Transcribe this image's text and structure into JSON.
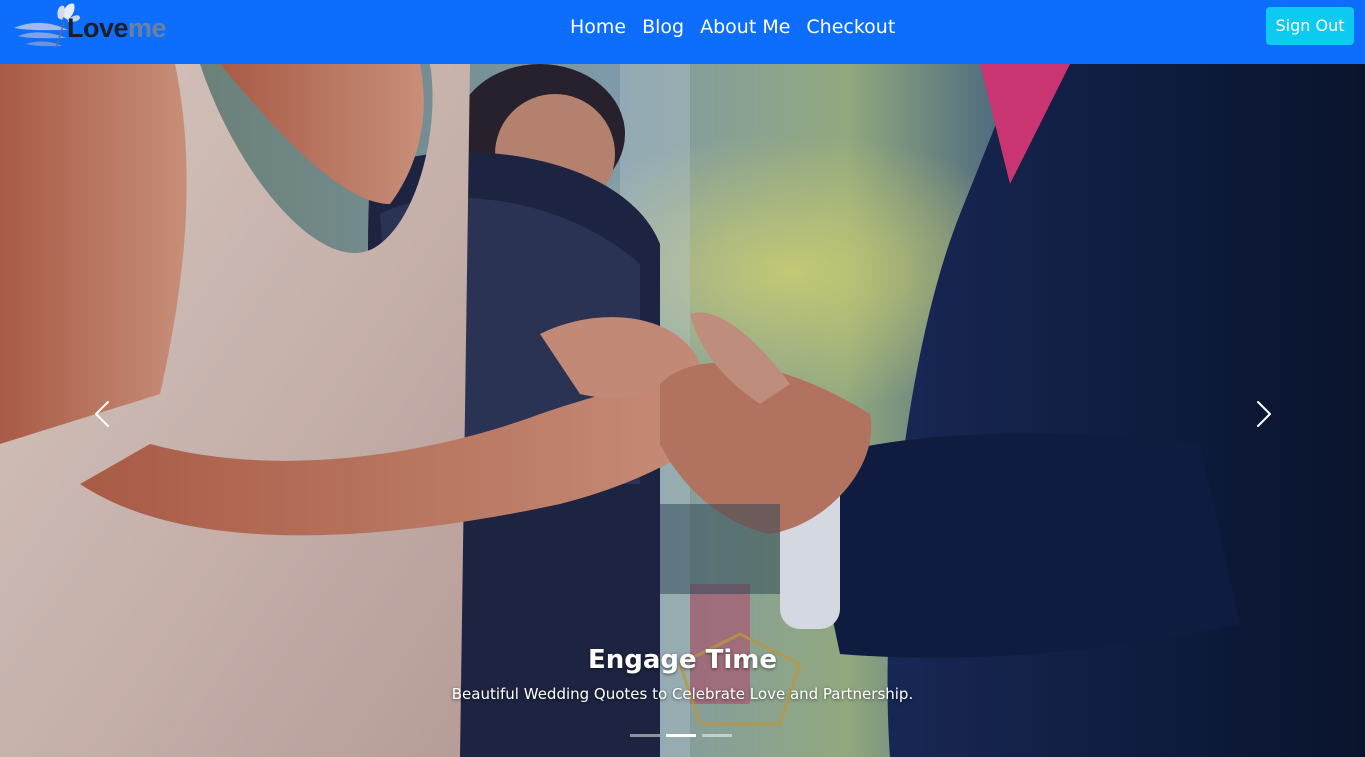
{
  "navbar": {
    "brand": {
      "love": "Love",
      "me": "me"
    },
    "links": [
      "Home",
      "Blog",
      "About Me",
      "Checkout"
    ],
    "signout_label": "Sign Out",
    "colors": {
      "bar": "#0d6efd",
      "signout": "#0dcaf0"
    }
  },
  "carousel": {
    "prev_icon": "chevron-left-icon",
    "next_icon": "chevron-right-icon",
    "caption_title": "Engage Time",
    "caption_subtitle": "Beautiful Wedding Quotes to Celebrate Love and Partnership.",
    "slide_count": 3,
    "active_slide": 2
  }
}
